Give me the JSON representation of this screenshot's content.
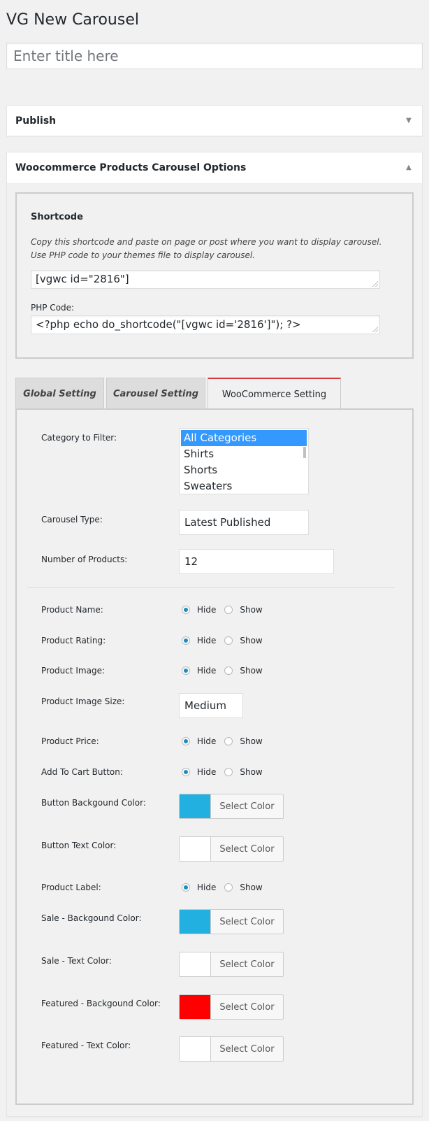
{
  "page": {
    "title": "VG New Carousel"
  },
  "title_input": {
    "placeholder": "Enter title here"
  },
  "publish_box": {
    "title": "Publish"
  },
  "options_box": {
    "title": "Woocommerce Products Carousel Options"
  },
  "shortcode": {
    "heading": "Shortcode",
    "desc_line1": "Copy this shortcode and paste on page or post where you want to display carousel.",
    "desc_line2": "Use PHP code to your themes file to display carousel.",
    "shortcode_value": "[vgwc id=\"2816\"]",
    "php_label": "PHP Code:",
    "php_value": "<?php echo do_shortcode(\"[vgwc id='2816']\"); ?>"
  },
  "tabs": [
    {
      "label": "Global Setting"
    },
    {
      "label": "Carousel Setting"
    },
    {
      "label": "WooCommerce Setting"
    }
  ],
  "settings": {
    "category_label": "Category to Filter:",
    "category_options": [
      "All Categories",
      "Shirts",
      "Shorts",
      "Sweaters"
    ],
    "carousel_type_label": "Carousel Type:",
    "carousel_type_value": "Latest Published",
    "num_products_label": "Number of Products:",
    "num_products_value": "12",
    "hide_label": "Hide",
    "show_label": "Show",
    "product_name_label": "Product Name:",
    "product_rating_label": "Product Rating:",
    "product_image_label": "Product Image:",
    "product_image_size_label": "Product Image Size:",
    "product_image_size_value": "Medium",
    "product_price_label": "Product Price:",
    "add_to_cart_label": "Add To Cart Button:",
    "button_bg_label": "Button Backgound Color:",
    "button_text_label": "Button Text Color:",
    "product_label_label": "Product Label:",
    "sale_bg_label": "Sale - Backgound Color:",
    "sale_text_label": "Sale - Text Color:",
    "featured_bg_label": "Featured - Backgound Color:",
    "featured_text_label": "Featured - Text Color:",
    "select_color_label": "Select Color"
  },
  "colors": {
    "button_bg": "#22b0e0",
    "button_text": "#ffffff",
    "sale_bg": "#22b0e0",
    "sale_text": "#ffffff",
    "featured_bg": "#ff0000",
    "featured_text": "#ffffff"
  }
}
